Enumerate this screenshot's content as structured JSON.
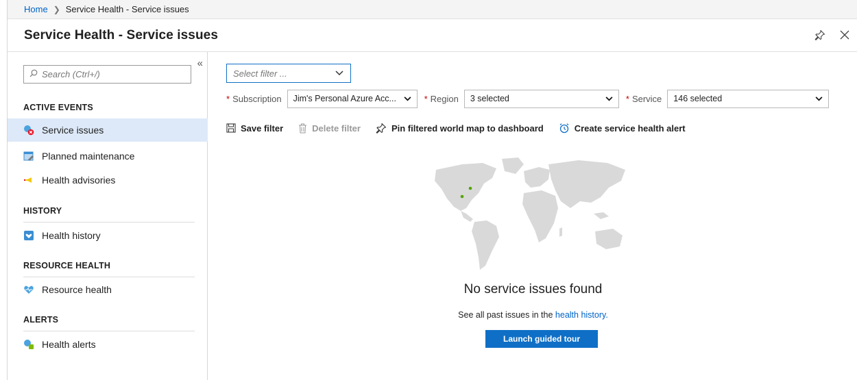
{
  "breadcrumb": {
    "home": "Home",
    "current": "Service Health - Service issues"
  },
  "title": "Service Health - Service issues",
  "sidebar": {
    "search_placeholder": "Search (Ctrl+/)",
    "sections": {
      "active_events": "ACTIVE EVENTS",
      "history": "HISTORY",
      "resource_health": "RESOURCE HEALTH",
      "alerts": "ALERTS"
    },
    "items": {
      "service_issues": "Service issues",
      "planned_maintenance": "Planned maintenance",
      "health_advisories": "Health advisories",
      "health_history": "Health history",
      "resource_health": "Resource health",
      "health_alerts": "Health alerts"
    }
  },
  "filters": {
    "select_filter_placeholder": "Select filter ...",
    "subscription_label": "Subscription",
    "subscription_value": "Jim's Personal Azure Acc...",
    "region_label": "Region",
    "region_value": "3 selected",
    "service_label": "Service",
    "service_value": "146 selected"
  },
  "toolbar": {
    "save_filter": "Save filter",
    "delete_filter": "Delete filter",
    "pin_map": "Pin filtered world map to dashboard",
    "create_alert": "Create service health alert"
  },
  "empty_state": {
    "title": "No service issues found",
    "sub_prefix": "See all past issues in the",
    "sub_link": "health history.",
    "button": "Launch guided tour"
  },
  "colors": {
    "accent": "#0f6fc6",
    "link": "#0063c7",
    "active_nav": "#dde9f8",
    "map_land": "#d9d9d9",
    "map_point": "#57a300"
  }
}
